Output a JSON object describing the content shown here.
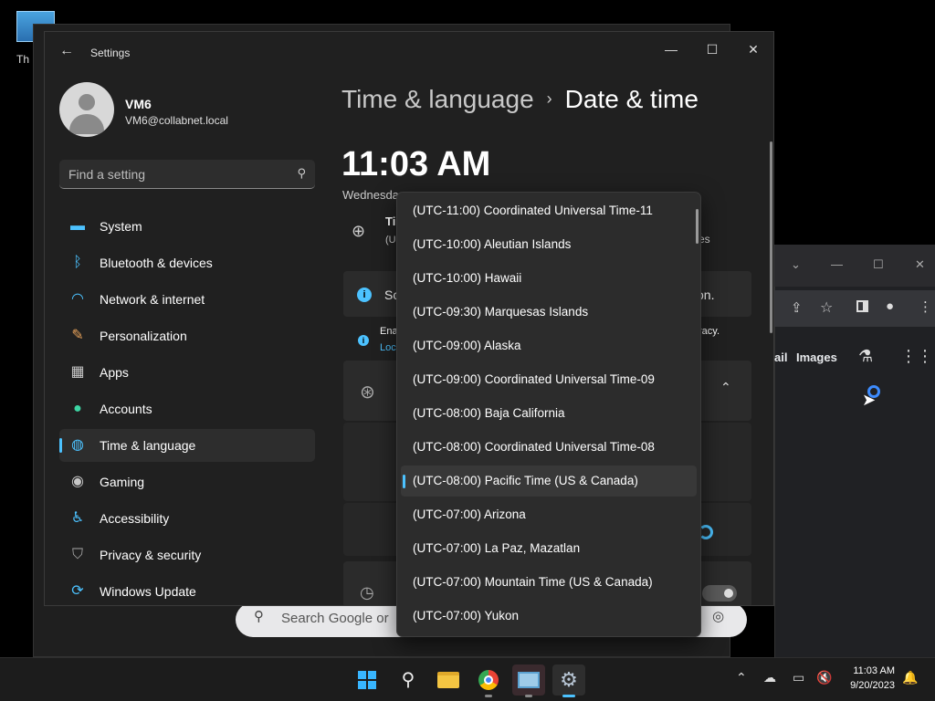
{
  "desktop": {
    "icon_label": "Th"
  },
  "settings": {
    "app_title": "Settings",
    "window_controls": {
      "minimize": "—",
      "maximize": "☐",
      "close": "✕"
    },
    "user": {
      "name": "VM6",
      "email": "VM6@collabnet.local"
    },
    "search": {
      "placeholder": "Find a setting"
    },
    "nav": [
      {
        "label": "System",
        "icon": "monitor-icon",
        "color": "#4cc2ff"
      },
      {
        "label": "Bluetooth & devices",
        "icon": "bluetooth-icon",
        "color": "#4cc2ff"
      },
      {
        "label": "Network & internet",
        "icon": "wifi-icon",
        "color": "#4cc2ff"
      },
      {
        "label": "Personalization",
        "icon": "brush-icon",
        "color": "#e8a25a"
      },
      {
        "label": "Apps",
        "icon": "apps-icon",
        "color": "#c7c7c7"
      },
      {
        "label": "Accounts",
        "icon": "person-icon",
        "color": "#3dd6a4"
      },
      {
        "label": "Time & language",
        "icon": "globe-clock-icon",
        "color": "#4cc2ff",
        "selected": true
      },
      {
        "label": "Gaming",
        "icon": "gamepad-icon",
        "color": "#c7c7c7"
      },
      {
        "label": "Accessibility",
        "icon": "accessibility-icon",
        "color": "#4cc2ff"
      },
      {
        "label": "Privacy & security",
        "icon": "shield-icon",
        "color": "#aaaaaa"
      },
      {
        "label": "Windows Update",
        "icon": "update-icon",
        "color": "#4cc2ff"
      }
    ],
    "breadcrumb": {
      "parent": "Time & language",
      "separator": "›",
      "current": "Date & time"
    },
    "time": "11:03 AM",
    "date_partial": "Wednesda",
    "tz_row": {
      "title": "Ti",
      "sub": "(U",
      "right_tail": "es"
    },
    "info_banner": {
      "text": "Sc",
      "tail": "on."
    },
    "info_small": {
      "line1": "Ena",
      "line2": "Loc",
      "tail": "racy."
    }
  },
  "timezone_dropdown": {
    "options": [
      "(UTC-11:00) Coordinated Universal Time-11",
      "(UTC-10:00) Aleutian Islands",
      "(UTC-10:00) Hawaii",
      "(UTC-09:30) Marquesas Islands",
      "(UTC-09:00) Alaska",
      "(UTC-09:00) Coordinated Universal Time-09",
      "(UTC-08:00) Baja California",
      "(UTC-08:00) Coordinated Universal Time-08",
      "(UTC-08:00) Pacific Time (US & Canada)",
      "(UTC-07:00) Arizona",
      "(UTC-07:00) La Paz, Mazatlan",
      "(UTC-07:00) Mountain Time (US & Canada)",
      "(UTC-07:00) Yukon"
    ],
    "selected": "(UTC-08:00) Pacific Time (US & Canada)"
  },
  "chrome": {
    "tab_ail": "ail",
    "images_link": "Images",
    "search_placeholder": "Search Google or",
    "window_controls": {
      "dropdown": "⌄",
      "minimize": "—",
      "maximize": "☐",
      "close": "✕"
    }
  },
  "taskbar": {
    "apps": [
      {
        "name": "start-button",
        "icon": "windows-logo-icon"
      },
      {
        "name": "search-button",
        "icon": "search-icon"
      },
      {
        "name": "file-explorer-button",
        "icon": "folder-icon"
      },
      {
        "name": "chrome-button",
        "icon": "chrome-icon"
      },
      {
        "name": "task-manager-button",
        "icon": "monitor-chart-icon"
      },
      {
        "name": "settings-button",
        "icon": "gear-icon",
        "active": true
      }
    ],
    "clock": {
      "time": "11:03 AM",
      "date": "9/20/2023"
    }
  }
}
